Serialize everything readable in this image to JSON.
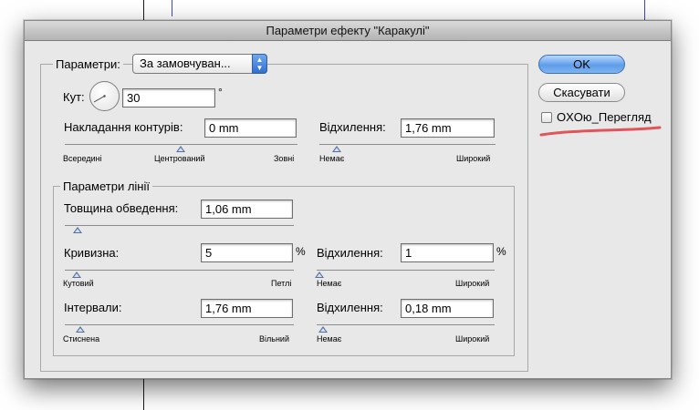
{
  "dialog": {
    "title": "Параметри ефекту \"Каракулі\""
  },
  "settings": {
    "label": "Параметри:",
    "preset_value": "За замовчуван...",
    "popup_arrows": "▲\n▼"
  },
  "angle": {
    "label": "Кут:",
    "value": "30",
    "unit": "°"
  },
  "path_overlap": {
    "label": "Накладання контурів:",
    "value": "0 mm",
    "ticks": [
      "Всередині",
      "Центрований",
      "Зовні"
    ],
    "slider_fraction": 0.5
  },
  "variation_top": {
    "label": "Відхилення:",
    "value": "1,76 mm",
    "ticks": [
      "Немає",
      "Широкий"
    ],
    "slider_fraction": 0.1
  },
  "line_options": {
    "legend": "Параметри лінії",
    "stroke_width": {
      "label": "Товщина обведення:",
      "value": "1,06 mm",
      "slider_fraction": 0.05
    },
    "curviness": {
      "label": "Кривизна:",
      "value": "5",
      "unit": "%",
      "ticks": [
        "Кутовий",
        "Петлі"
      ],
      "slider_fraction": 0.05
    },
    "curviness_variation": {
      "label": "Відхилення:",
      "value": "1",
      "unit": "%",
      "ticks": [
        "Немає",
        "Широкий"
      ],
      "slider_fraction": 0.01
    },
    "spacing": {
      "label": "Інтервали:",
      "value": "1,76 mm",
      "ticks": [
        "Стиснена",
        "Вільний"
      ],
      "slider_fraction": 0.1
    },
    "spacing_variation": {
      "label": "Відхилення:",
      "value": "0,18 mm",
      "ticks": [
        "Немає",
        "Широкий"
      ],
      "slider_fraction": 0.05
    }
  },
  "buttons": {
    "ok": "OK",
    "cancel": "Скасувати"
  },
  "preview": {
    "label": "OXOю_Перегляд",
    "checked": false,
    "underline_color": "#e0555b"
  },
  "colors": {
    "ok_button": "#5f9de9",
    "popup_arrow": "#2f6fd0",
    "annotation": "#e0555b"
  }
}
